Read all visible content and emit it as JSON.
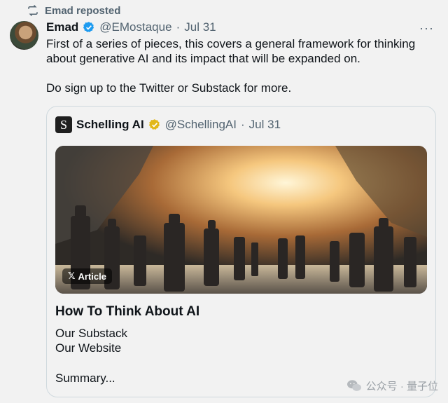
{
  "repost": {
    "label": "Emad reposted"
  },
  "tweet": {
    "author_name": "Emad",
    "handle": "@EMostaque",
    "separator": "·",
    "date": "Jul 31",
    "more": "···",
    "paragraphs": [
      "First of a series of pieces, this covers a general framework for thinking about generative AI and its impact that will be expanded on.",
      "Do sign up to the Twitter or Substack for more."
    ]
  },
  "quote": {
    "avatar_letter": "S",
    "author_name": "Schelling AI",
    "handle": "@SchellingAI",
    "separator": "·",
    "date": "Jul 31",
    "article": {
      "badge": "Article",
      "title": "How To Think About AI",
      "links": [
        "Our Substack",
        "Our Website"
      ],
      "summary": "Summary..."
    }
  },
  "watermark": {
    "text": "公众号 · 量子位"
  },
  "colors": {
    "background": "#f2f2f2",
    "verified_blue": "#1d9bf0",
    "verified_gold": "#e2b719",
    "secondary_text": "#536471"
  }
}
